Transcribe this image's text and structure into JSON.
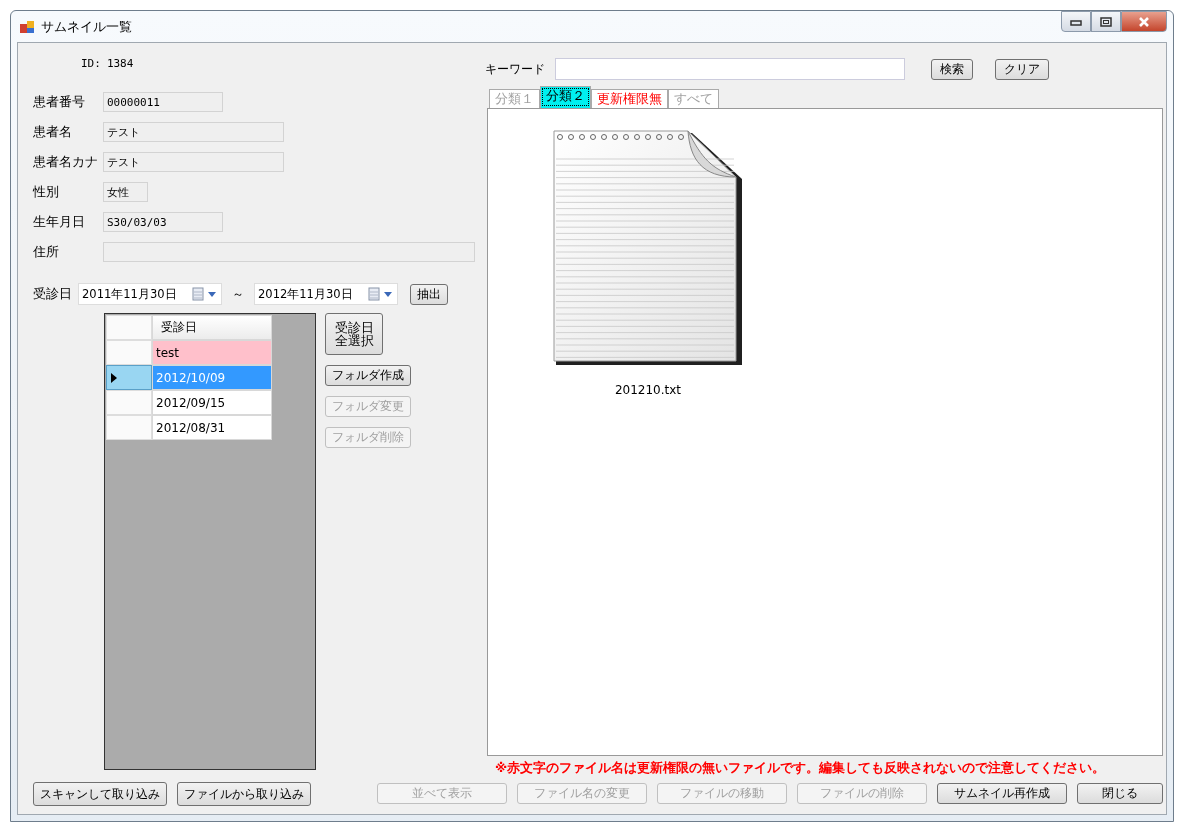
{
  "window": {
    "title": "サムネイル一覧"
  },
  "patient": {
    "id_label": "ID:",
    "id": "1384",
    "fields": [
      {
        "label": "患者番号",
        "value": "00000011"
      },
      {
        "label": "患者名",
        "value": "テスト"
      },
      {
        "label": "患者名カナ",
        "value": "テスト"
      },
      {
        "label": "性別",
        "value": "女性"
      },
      {
        "label": "生年月日",
        "value": "S30/03/03"
      },
      {
        "label": "住所"
      }
    ]
  },
  "date_filter": {
    "label": "受診日",
    "from": "2011年11月30日",
    "separator": "～",
    "to": "2012年11月30日",
    "button": "抽出"
  },
  "visit_grid": {
    "column": "受診日",
    "rows": [
      {
        "value": "test",
        "selected": false,
        "highlight": true
      },
      {
        "value": "2012/10/09",
        "selected": true,
        "highlight": false
      },
      {
        "value": "2012/09/15",
        "selected": false,
        "highlight": false
      },
      {
        "value": "2012/08/31",
        "selected": false,
        "highlight": false
      }
    ]
  },
  "folder_buttons": [
    {
      "label": "受診日全選択",
      "disabled": false,
      "kind": "tall"
    },
    {
      "label": "フォルダ作成",
      "disabled": false,
      "kind": "normal"
    },
    {
      "label": "フォルダ変更",
      "disabled": true,
      "kind": "normal"
    },
    {
      "label": "フォルダ削除",
      "disabled": true,
      "kind": "normal"
    }
  ],
  "keyword": {
    "label": "キーワード",
    "search": "検索",
    "clear": "クリア"
  },
  "tabs": [
    {
      "label": "分類１",
      "selected": false,
      "restricted": false
    },
    {
      "label": "分類２",
      "selected": true,
      "restricted": false
    },
    {
      "label": "更新権限無",
      "selected": false,
      "restricted": true
    },
    {
      "label": "すべて",
      "selected": false,
      "restricted": false
    }
  ],
  "files": [
    {
      "name": "201210.txt"
    }
  ],
  "warning": "※赤文字のファイル名は更新権限の無いファイルです。編集しても反映されないので注意してください。",
  "left_buttons": [
    {
      "label": "スキャンして取り込み",
      "disabled": false
    },
    {
      "label": "ファイルから取り込み",
      "disabled": false
    }
  ],
  "right_buttons": [
    {
      "label": "並べて表示",
      "disabled": true
    },
    {
      "label": "ファイル名の変更",
      "disabled": true
    },
    {
      "label": "ファイルの移動",
      "disabled": true
    },
    {
      "label": "ファイルの削除",
      "disabled": true
    },
    {
      "label": "サムネイル再作成",
      "disabled": false
    },
    {
      "label": "閉じる",
      "disabled": false
    }
  ]
}
